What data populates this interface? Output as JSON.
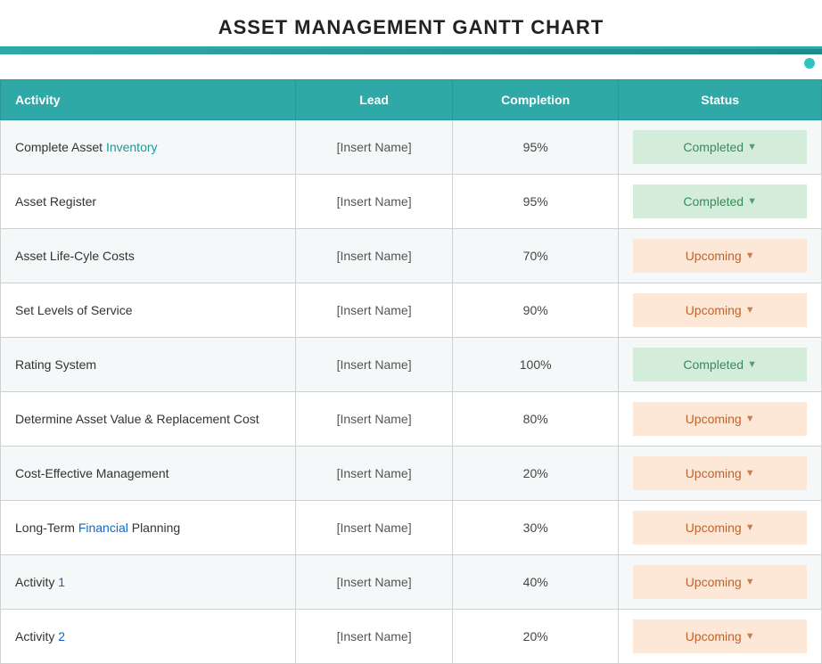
{
  "page": {
    "title": "ASSET MANAGEMENT GANTT CHART"
  },
  "table": {
    "headers": {
      "activity": "Activity",
      "lead": "Lead",
      "completion": "Completion",
      "status": "Status"
    },
    "rows": [
      {
        "activity": "Complete Asset Inventory",
        "activity_parts": [
          {
            "text": "Complete Asset ",
            "highlight": false
          },
          {
            "text": "Inventory",
            "highlight": true
          }
        ],
        "lead": "[Insert Name]",
        "completion": "95%",
        "status": "Completed",
        "status_type": "completed"
      },
      {
        "activity": "Asset Register",
        "lead": "[Insert Name]",
        "completion": "95%",
        "status": "Completed",
        "status_type": "completed"
      },
      {
        "activity": "Asset Life-Cyle Costs",
        "lead": "[Insert Name]",
        "completion": "70%",
        "status": "Upcoming",
        "status_type": "upcoming"
      },
      {
        "activity": "Set Levels of Service",
        "lead": "[Insert Name]",
        "completion": "90%",
        "status": "Upcoming",
        "status_type": "upcoming"
      },
      {
        "activity": "Rating System",
        "lead": "[Insert Name]",
        "completion": "100%",
        "status": "Completed",
        "status_type": "completed"
      },
      {
        "activity": "Determine Asset Value & Replacement Cost",
        "lead": "[Insert Name]",
        "completion": "80%",
        "status": "Upcoming",
        "status_type": "upcoming"
      },
      {
        "activity": "Cost-Effective Management",
        "lead": "[Insert Name]",
        "completion": "20%",
        "status": "Upcoming",
        "status_type": "upcoming"
      },
      {
        "activity": "Long-Term Financial Planning",
        "activity_parts": [
          {
            "text": "Long-Term ",
            "highlight": false
          },
          {
            "text": "Financial",
            "highlight": true
          },
          {
            "text": " Planning",
            "highlight": false
          }
        ],
        "lead": "[Insert Name]",
        "completion": "30%",
        "status": "Upcoming",
        "status_type": "upcoming"
      },
      {
        "activity": "Activity 1",
        "activity_parts": [
          {
            "text": "Activity ",
            "highlight": false
          },
          {
            "text": "1",
            "highlight": true,
            "blue": true
          }
        ],
        "lead": "[Insert Name]",
        "completion": "40%",
        "status": "Upcoming",
        "status_type": "upcoming"
      },
      {
        "activity": "Activity 2",
        "activity_parts": [
          {
            "text": "Activity ",
            "highlight": false
          },
          {
            "text": "2",
            "highlight": true,
            "blue": true
          }
        ],
        "lead": "[Insert Name]",
        "completion": "20%",
        "status": "Upcoming",
        "status_type": "upcoming"
      }
    ],
    "lead_placeholder": "[Insert Name]"
  }
}
